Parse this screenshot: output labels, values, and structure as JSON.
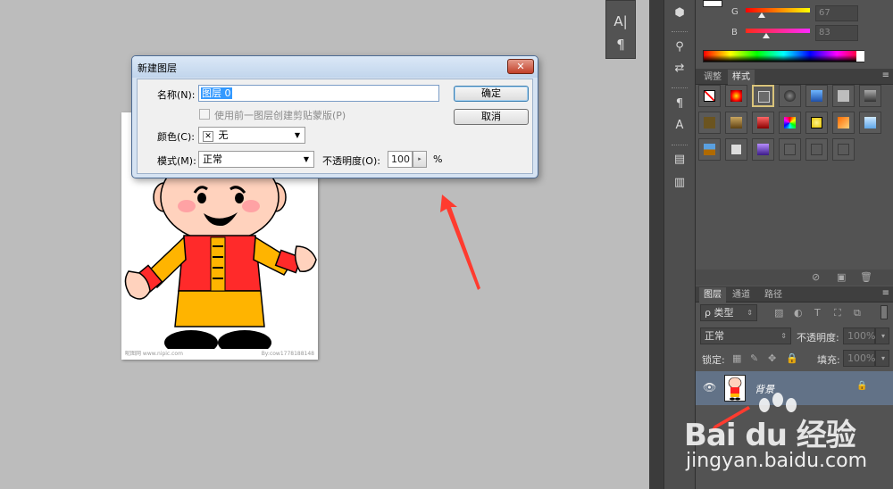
{
  "dialog": {
    "title": "新建图层",
    "close_label": "✕",
    "name_label": "名称(N):",
    "name_value": "图层 0",
    "ok_label": "确定",
    "cancel_label": "取消",
    "clip_label": "使用前一图层创建剪贴蒙版(P)",
    "clip_checked": false,
    "color_label": "颜色(C):",
    "color_icon": "✕",
    "color_value": "无",
    "mode_label": "模式(M):",
    "mode_value": "正常",
    "opacity_label": "不透明度(O):",
    "opacity_value": "100",
    "opacity_unit": "%"
  },
  "color_panel": {
    "g_label": "G",
    "g_value": "67",
    "b_label": "B",
    "b_value": "83"
  },
  "styles_panel": {
    "tabs": [
      "调整",
      "样式"
    ],
    "active_tab": "样式"
  },
  "layers_panel": {
    "tabs": [
      "图层",
      "通道",
      "路径"
    ],
    "active_tab": "图层",
    "filter_label": "ρ 类型",
    "blend_mode": "正常",
    "opacity_label": "不透明度:",
    "opacity_value": "100%",
    "lock_label": "锁定:",
    "fill_label": "填充:",
    "fill_value": "100%",
    "layer_name": "背景"
  },
  "canvas": {
    "footer_left": "昵图网 www.nipic.com",
    "footer_right": "By:cow1778188148"
  },
  "watermark": {
    "brand": "Bai du 经验",
    "url": "jingyan.baidu.com"
  },
  "colors": {
    "panel_bg": "#535353",
    "dialog_frame": "#d6e3f2",
    "layer_selected": "#627287",
    "arrow": "#ff3b2f"
  }
}
